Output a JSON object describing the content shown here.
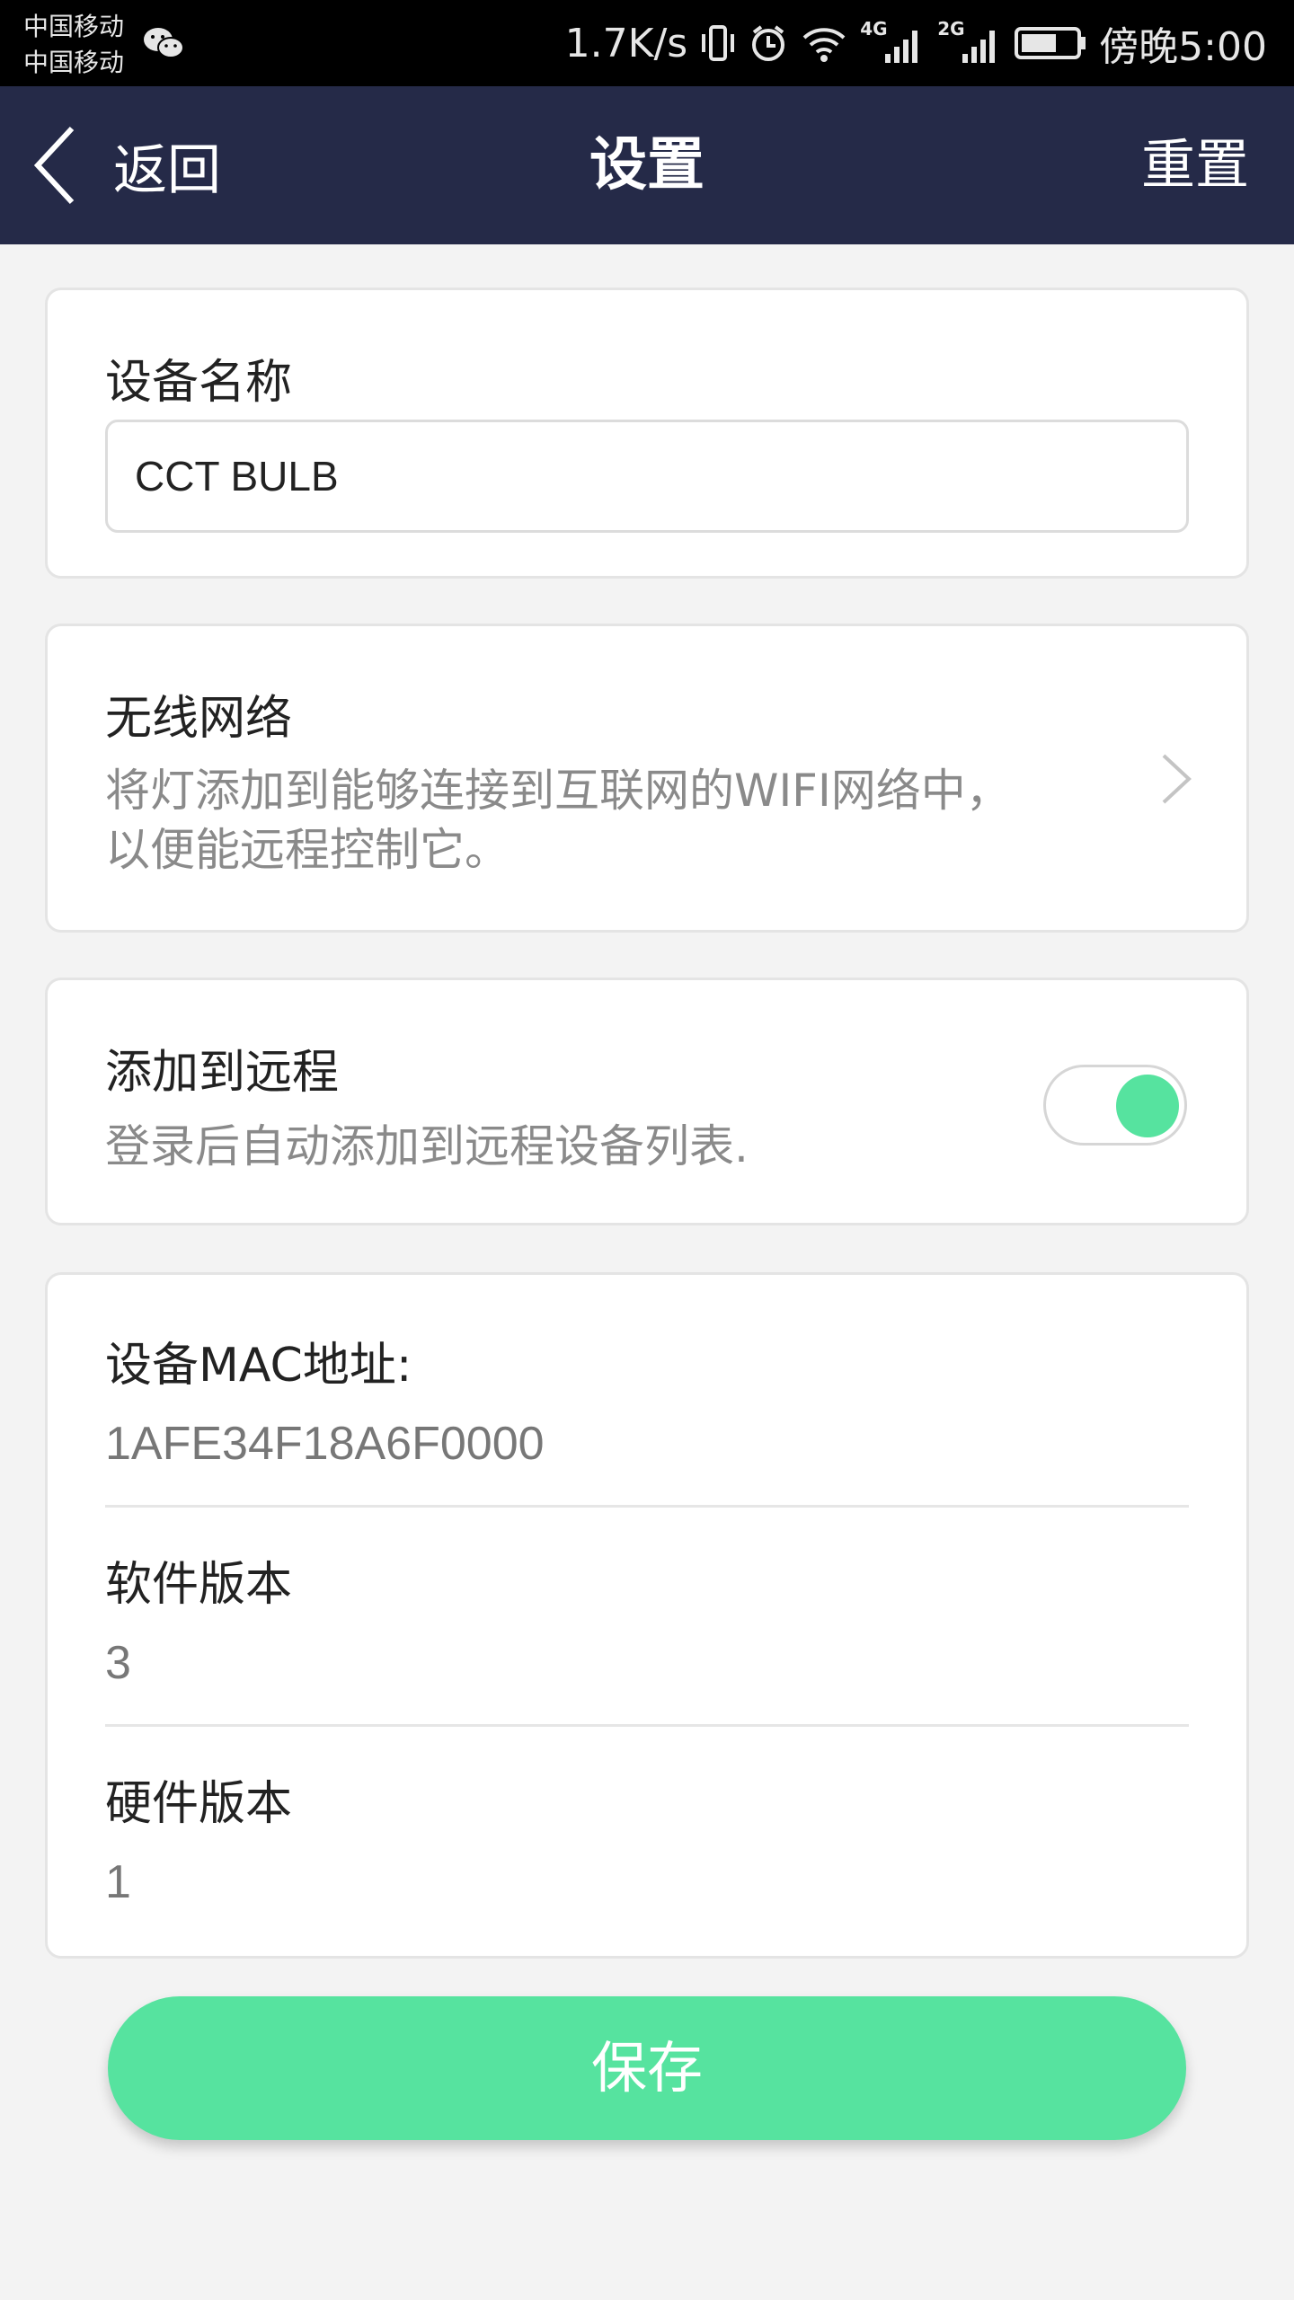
{
  "status_bar": {
    "carrier_1": "中国移动",
    "carrier_2": "中国移动",
    "net_speed": "1.7K/s",
    "network_1": "4G",
    "network_2": "2G",
    "time": "傍晚5:00"
  },
  "nav": {
    "back_label": "返回",
    "title": "设置",
    "reset_label": "重置"
  },
  "device_name": {
    "label": "设备名称",
    "value": "CCT BULB"
  },
  "wifi": {
    "title": "无线网络",
    "desc_line1": "将灯添加到能够连接到互联网的WIFI网络中，",
    "desc_line2": "以便能远程控制它。"
  },
  "remote": {
    "title": "添加到远程",
    "desc": "登录后自动添加到远程设备列表.",
    "enabled": true
  },
  "info": {
    "mac_label": "设备MAC地址:",
    "mac_value": "1AFE34F18A6F0000",
    "software_label": "软件版本",
    "software_value": "3",
    "hardware_label": "硬件版本",
    "hardware_value": "1"
  },
  "save_label": "保存",
  "colors": {
    "nav_bg": "#252a48",
    "accent": "#56e39f",
    "page_bg": "#f3f3f3"
  }
}
